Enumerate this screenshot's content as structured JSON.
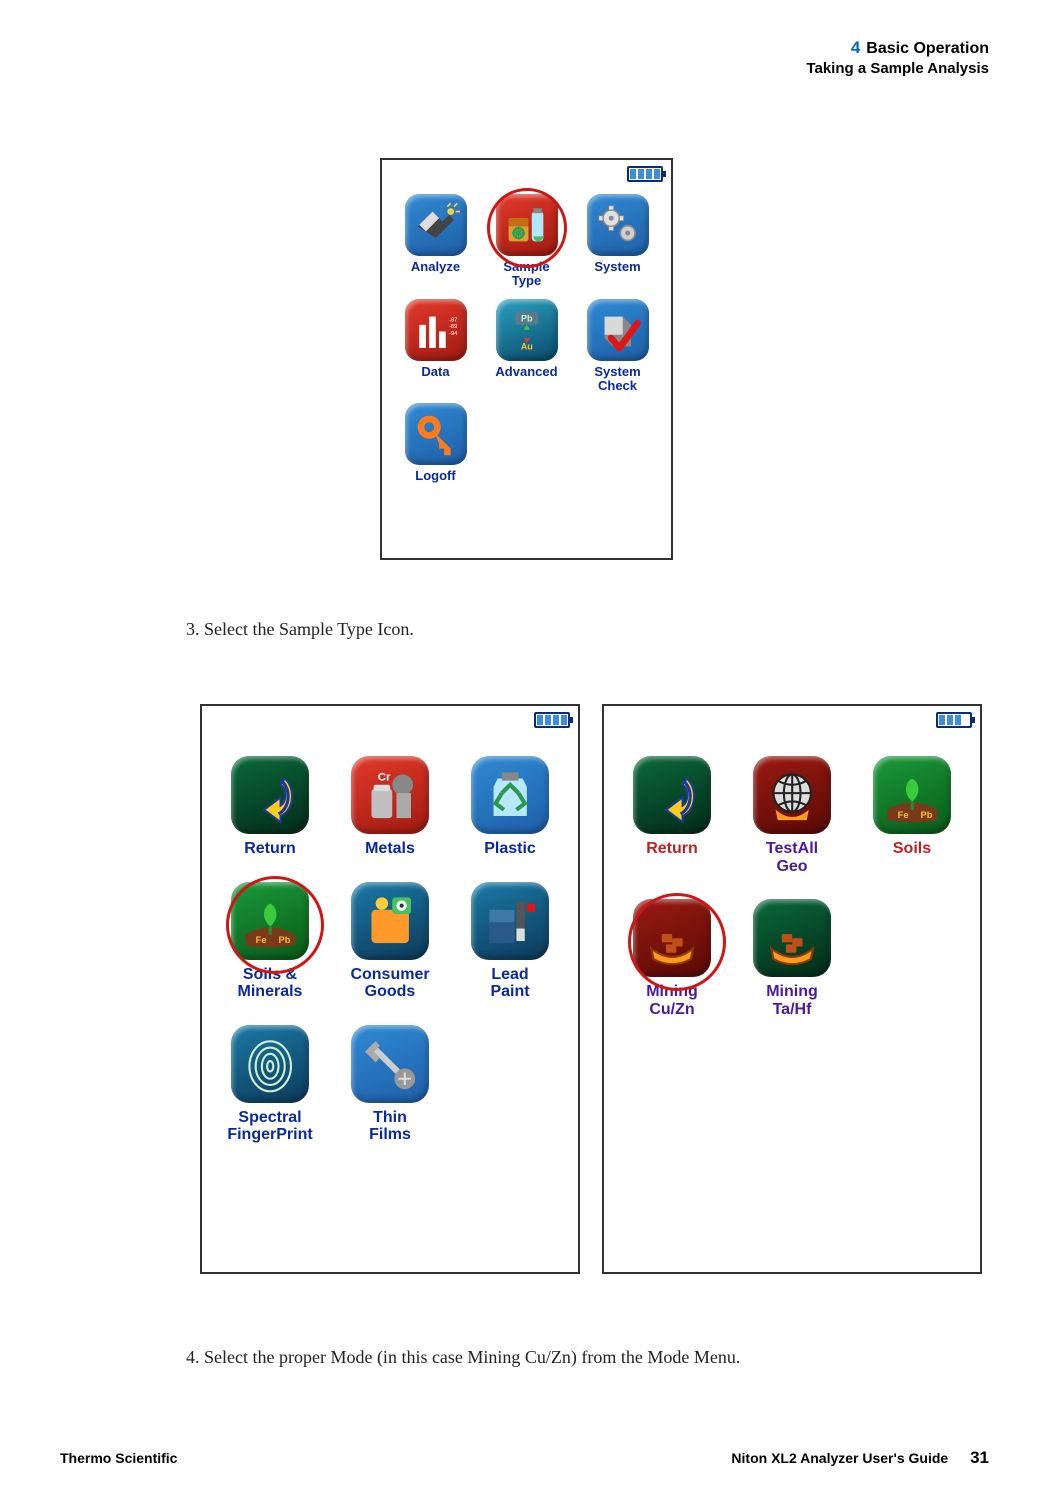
{
  "header": {
    "chapter_num": "4",
    "chapter_title": "Basic Operation",
    "section_title": "Taking a Sample Analysis"
  },
  "steps": {
    "s3": "3. Select the Sample Type Icon.",
    "s4": "4. Select the proper Mode (in this case Mining Cu/Zn) from the Mode Menu."
  },
  "footer": {
    "left": "Thermo Scientific",
    "right_title": "Niton XL2 Analyzer User's Guide",
    "page": "31"
  },
  "screen1": {
    "items": [
      {
        "label": "Analyze",
        "color": "c-blue",
        "icon": "analyzer"
      },
      {
        "label": "Sample\nType",
        "color": "c-red",
        "icon": "sample",
        "circled": true
      },
      {
        "label": "System",
        "color": "c-blue",
        "icon": "gears"
      },
      {
        "label": "Data",
        "color": "c-red",
        "icon": "data"
      },
      {
        "label": "Advanced",
        "color": "c-teal",
        "icon": "pbau"
      },
      {
        "label": "System\nCheck",
        "color": "c-blue",
        "icon": "check"
      },
      {
        "label": "Logoff",
        "color": "c-blue",
        "icon": "key"
      }
    ]
  },
  "screen2": {
    "items": [
      {
        "label": "Return",
        "color": "c-darkgreen",
        "icon": "return"
      },
      {
        "label": "Metals",
        "color": "c-red",
        "icon": "metals"
      },
      {
        "label": "Plastic",
        "color": "c-blue",
        "icon": "plastic"
      },
      {
        "label": "Soils &\nMinerals",
        "color": "c-green",
        "icon": "soils",
        "circled": true
      },
      {
        "label": "Consumer\nGoods",
        "color": "c-teal2",
        "icon": "consumer"
      },
      {
        "label": "Lead\nPaint",
        "color": "c-teal2",
        "icon": "paint"
      },
      {
        "label": "Spectral\nFingerPrint",
        "color": "c-teal2",
        "icon": "finger"
      },
      {
        "label": "Thin\nFilms",
        "color": "c-blue",
        "icon": "caliper"
      }
    ]
  },
  "screen3": {
    "items": [
      {
        "label": "Return",
        "color": "c-darkgreen",
        "icon": "return",
        "label_class": "label-red"
      },
      {
        "label": "TestAll\nGeo",
        "color": "c-darkred",
        "icon": "globe",
        "label_class": "label-purple"
      },
      {
        "label": "Soils",
        "color": "c-green",
        "icon": "soils",
        "label_class": "label-red"
      },
      {
        "label": "Mining\nCu/Zn",
        "color": "c-darkred",
        "icon": "minecu",
        "circled": true,
        "label_class": "label-purple"
      },
      {
        "label": "Mining\nTa/Hf",
        "color": "c-darkgreen",
        "icon": "mineta",
        "label_class": "label-purple"
      }
    ]
  }
}
